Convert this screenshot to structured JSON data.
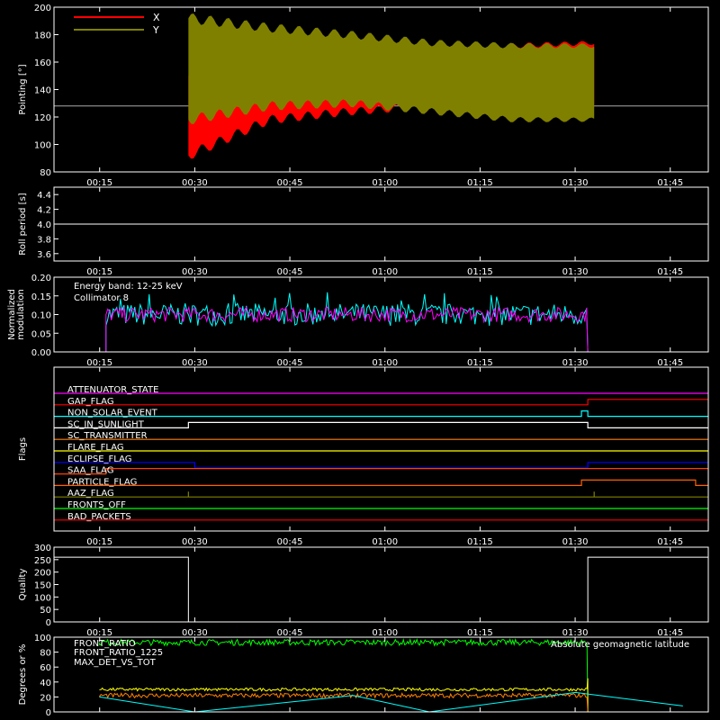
{
  "colors": {
    "background": "#000000",
    "axes": "#ffffff",
    "pointing_x": "#ff0000",
    "pointing_y": "#808000",
    "front_ratio": "#00ff00",
    "front_ratio_1225": "#ffff00",
    "max_det": "#ff8000",
    "geomag": "#00ffff",
    "modulation_a": "#00ffff",
    "modulation_b": "#ff00ff"
  },
  "chart_data": [
    {
      "type": "line",
      "id": "pointing",
      "ylabel": "Pointing [°]",
      "ylim": [
        80,
        200
      ],
      "yticks": [
        "80",
        "100",
        "120",
        "140",
        "160",
        "180",
        "200"
      ],
      "xlim_hours": [
        0.15,
        1.85
      ],
      "xticks": [
        "00:15",
        "00:30",
        "00:45",
        "01:00",
        "01:15",
        "01:30",
        "01:45"
      ],
      "series": [
        {
          "name": "X",
          "color": "#ff0000",
          "start": "00:29",
          "end": "01:33",
          "values_min": [
            92,
            118,
            124,
            128,
            128,
            128
          ],
          "values_max": [
            150,
            160,
            165,
            170,
            172,
            174
          ]
        },
        {
          "name": "Y",
          "color": "#808000",
          "start": "00:29",
          "end": "01:33",
          "values_min": [
            118,
            128,
            130,
            124,
            118,
            118
          ],
          "values_max": [
            192,
            185,
            180,
            174,
            172,
            172
          ]
        }
      ],
      "baseline": 128
    },
    {
      "type": "line",
      "id": "roll",
      "ylabel": "Roll period [s]",
      "ylim": [
        3.5,
        4.5
      ],
      "yticks": [
        "3.6",
        "3.8",
        "4.0",
        "4.2",
        "4.4"
      ],
      "xticks": [
        "00:15",
        "00:30",
        "00:45",
        "01:00",
        "01:15",
        "01:30",
        "01:45"
      ],
      "series": [
        {
          "name": "",
          "constant": 4.0
        }
      ]
    },
    {
      "type": "line",
      "id": "modulation",
      "ylabel": "Normalized modulation",
      "ylim": [
        0.0,
        0.2
      ],
      "yticks": [
        "0.00",
        "0.05",
        "0.10",
        "0.15",
        "0.20"
      ],
      "xticks": [
        "00:15",
        "00:30",
        "00:45",
        "01:00",
        "01:15",
        "01:30",
        "01:45"
      ],
      "annotations": [
        "Energy band: 12-25 keV",
        "Collimator 8"
      ],
      "series": [
        {
          "name": "Collimator 8",
          "color": "#00ffff",
          "start": "00:16",
          "end": "01:32",
          "mean": 0.1,
          "spread": 0.03
        },
        {
          "name": "",
          "color": "#ff00ff",
          "start": "00:16",
          "end": "01:32",
          "mean": 0.1,
          "spread": 0.02
        }
      ]
    },
    {
      "type": "line",
      "id": "flags",
      "ylabel": "Flags",
      "xticks": [
        "00:15",
        "00:30",
        "00:45",
        "01:00",
        "01:15",
        "01:30",
        "01:45"
      ],
      "series": [
        {
          "name": "ATTENUATOR_STATE",
          "color": "#ff00ff",
          "steps": []
        },
        {
          "name": "GAP_FLAG",
          "color": "#ff0000",
          "steps": [
            [
              "01:32",
              1
            ]
          ]
        },
        {
          "name": "NON_SOLAR_EVENT",
          "color": "#00ffff",
          "steps": [
            [
              "01:31",
              1
            ],
            [
              "01:32",
              0
            ]
          ]
        },
        {
          "name": "SC_IN_SUNLIGHT",
          "color": "#ffffff",
          "steps": [
            [
              "00:29",
              1
            ],
            [
              "01:32",
              0
            ]
          ]
        },
        {
          "name": "SC_TRANSMITTER",
          "color": "#ff8000",
          "steps": []
        },
        {
          "name": "FLARE_FLAG",
          "color": "#ffff00",
          "steps": []
        },
        {
          "name": "ECLIPSE_FLAG",
          "color": "#0000ff",
          "steps": [
            [
              "00:30",
              -1
            ],
            [
              "01:32",
              0
            ]
          ]
        },
        {
          "name": "SAA_FLAG",
          "color": "#ff4000",
          "steps": [
            [
              "00:16",
              1
            ],
            [
              "01:32",
              1
            ]
          ]
        },
        {
          "name": "PARTICLE_FLAG",
          "color": "#ff6000",
          "steps": [
            [
              "01:31",
              1
            ],
            [
              "01:49",
              0
            ]
          ]
        },
        {
          "name": "AAZ_FLAG",
          "color": "#808000",
          "steps": [
            [
              "00:29",
              1
            ],
            [
              "00:29",
              0
            ],
            [
              "01:33",
              1
            ],
            [
              "01:33",
              0
            ]
          ]
        },
        {
          "name": "FRONTS_OFF",
          "color": "#00ff00",
          "steps": []
        },
        {
          "name": "BAD_PACKETS",
          "color": "#ff0000",
          "steps": []
        }
      ]
    },
    {
      "type": "line",
      "id": "quality",
      "ylabel": "Quality",
      "ylim": [
        0,
        300
      ],
      "yticks": [
        "0",
        "50",
        "100",
        "150",
        "200",
        "250",
        "300"
      ],
      "xticks": [
        "00:15",
        "00:30",
        "00:45",
        "01:00",
        "01:15",
        "01:30",
        "01:45"
      ],
      "series": [
        {
          "name": "",
          "color": "#ffffff",
          "steps": [
            [
              "00:15",
              260
            ],
            [
              "00:29",
              0
            ],
            [
              "01:32",
              260
            ]
          ]
        }
      ]
    },
    {
      "type": "line",
      "id": "ratios",
      "ylabel": "Degrees or %",
      "ylim": [
        0,
        100
      ],
      "yticks": [
        "0",
        "20",
        "40",
        "60",
        "80",
        "100"
      ],
      "series": [
        {
          "name": "FRONT_RATIO",
          "color": "#00ff00",
          "start": "00:15",
          "end": "01:32",
          "mean": 93,
          "spread": 4
        },
        {
          "name": "FRONT_RATIO_1225",
          "color": "#ffff00",
          "start": "00:15",
          "end": "01:32",
          "mean": 30,
          "spread": 2
        },
        {
          "name": "MAX_DET_VS_TOT",
          "color": "#ff8000",
          "start": "00:15",
          "end": "01:32",
          "mean": 22,
          "spread": 3
        },
        {
          "name": "Absolute geomagnetic latitude",
          "color": "#00ffff",
          "points": [
            [
              "00:15",
              20
            ],
            [
              "00:30",
              0
            ],
            [
              "00:55",
              22
            ],
            [
              "01:07",
              0
            ],
            [
              "01:30",
              26
            ],
            [
              "01:47",
              8
            ]
          ]
        }
      ]
    }
  ]
}
